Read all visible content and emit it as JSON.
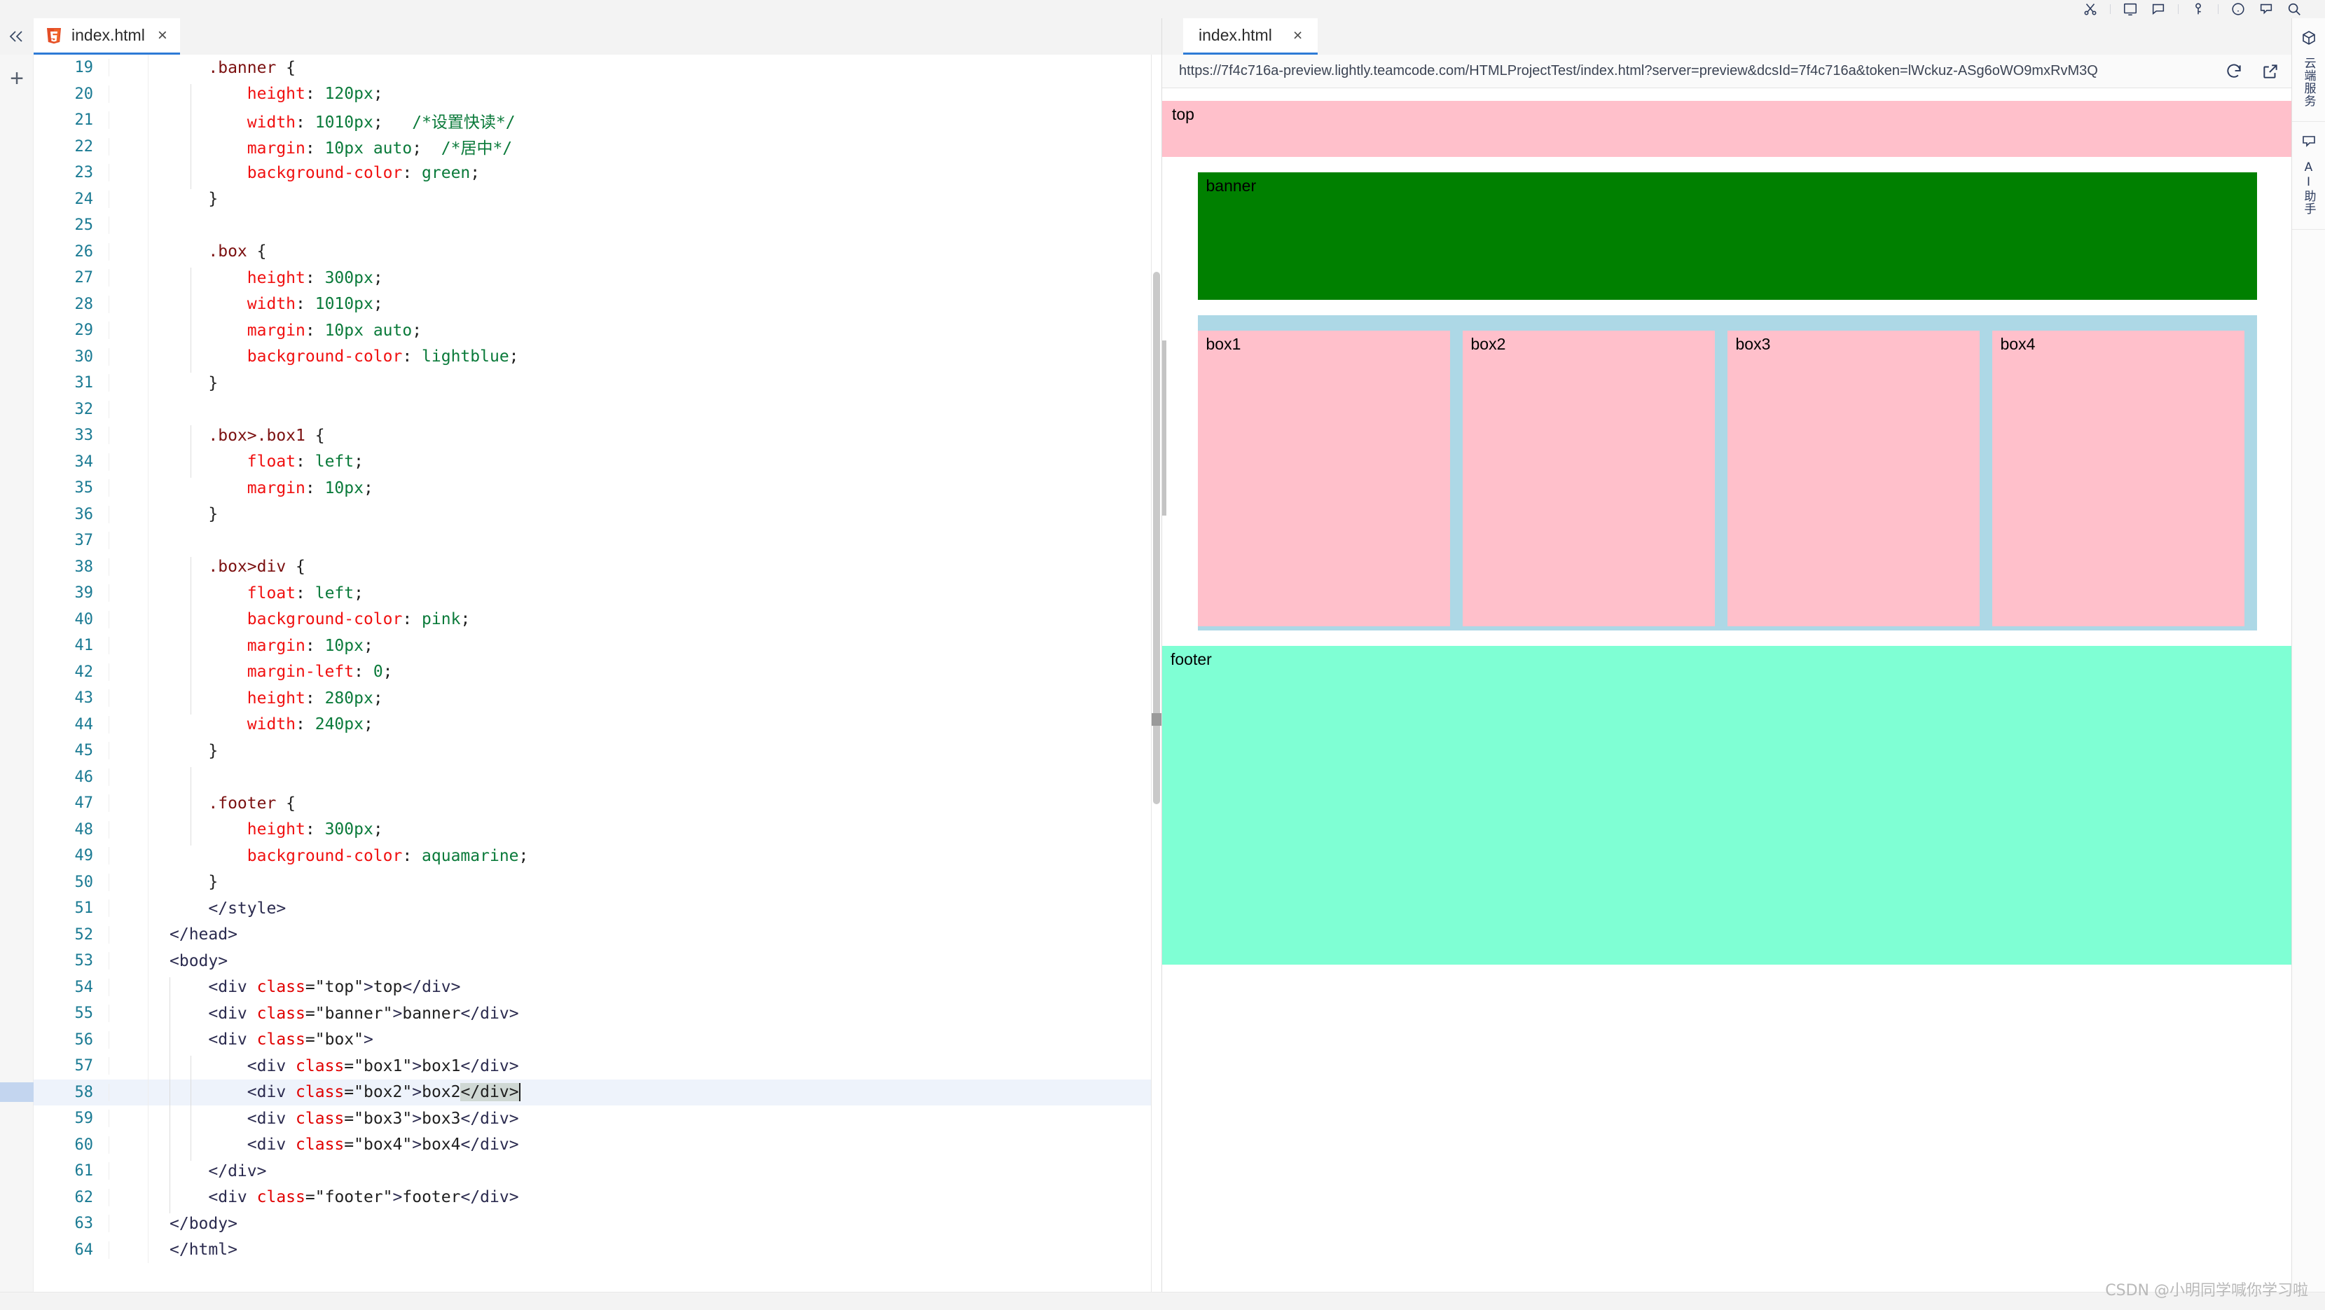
{
  "window": {
    "title": "index.html",
    "ide_toolbar_icons": [
      "scissors-icon",
      "terminal-icon",
      "comment-icon",
      "key-icon",
      "clock-icon",
      "chat-icon",
      "search-icon"
    ]
  },
  "editor": {
    "tab": {
      "label": "index.html",
      "icon": "html5-icon",
      "close": "×"
    },
    "collapse_icon": "chevron-double-left-icon",
    "add_icon": "+",
    "active_line": 58,
    "first_line": 19,
    "last_line": 64,
    "lines": [
      {
        "n": 19,
        "indent": 1,
        "tokens": [
          {
            "t": "sel",
            "v": ".banner"
          },
          {
            "t": "punc",
            "v": " {"
          }
        ]
      },
      {
        "n": 20,
        "indent": 2,
        "tokens": [
          {
            "t": "prop",
            "v": "height"
          },
          {
            "t": "punc",
            "v": ": "
          },
          {
            "t": "val",
            "v": "120px"
          },
          {
            "t": "punc",
            "v": ";"
          }
        ]
      },
      {
        "n": 21,
        "indent": 2,
        "tokens": [
          {
            "t": "prop",
            "v": "width"
          },
          {
            "t": "punc",
            "v": ": "
          },
          {
            "t": "val",
            "v": "1010px"
          },
          {
            "t": "punc",
            "v": ";"
          },
          {
            "t": "punc",
            "v": "   "
          },
          {
            "t": "com",
            "v": "/*设置快读*/"
          }
        ]
      },
      {
        "n": 22,
        "indent": 2,
        "tokens": [
          {
            "t": "prop",
            "v": "margin"
          },
          {
            "t": "punc",
            "v": ": "
          },
          {
            "t": "val",
            "v": "10px auto"
          },
          {
            "t": "punc",
            "v": ";"
          },
          {
            "t": "punc",
            "v": "  "
          },
          {
            "t": "com",
            "v": "/*居中*/"
          }
        ]
      },
      {
        "n": 23,
        "indent": 2,
        "tokens": [
          {
            "t": "prop",
            "v": "background-color"
          },
          {
            "t": "punc",
            "v": ": "
          },
          {
            "t": "val",
            "v": "green"
          },
          {
            "t": "punc",
            "v": ";"
          }
        ]
      },
      {
        "n": 24,
        "indent": 1,
        "tokens": [
          {
            "t": "punc",
            "v": "}"
          }
        ]
      },
      {
        "n": 25,
        "indent": 0,
        "tokens": []
      },
      {
        "n": 26,
        "indent": 1,
        "tokens": [
          {
            "t": "sel",
            "v": ".box"
          },
          {
            "t": "punc",
            "v": " {"
          }
        ]
      },
      {
        "n": 27,
        "indent": 2,
        "tokens": [
          {
            "t": "prop",
            "v": "height"
          },
          {
            "t": "punc",
            "v": ": "
          },
          {
            "t": "val",
            "v": "300px"
          },
          {
            "t": "punc",
            "v": ";"
          }
        ]
      },
      {
        "n": 28,
        "indent": 2,
        "tokens": [
          {
            "t": "prop",
            "v": "width"
          },
          {
            "t": "punc",
            "v": ": "
          },
          {
            "t": "val",
            "v": "1010px"
          },
          {
            "t": "punc",
            "v": ";"
          }
        ]
      },
      {
        "n": 29,
        "indent": 2,
        "tokens": [
          {
            "t": "prop",
            "v": "margin"
          },
          {
            "t": "punc",
            "v": ": "
          },
          {
            "t": "val",
            "v": "10px auto"
          },
          {
            "t": "punc",
            "v": ";"
          }
        ]
      },
      {
        "n": 30,
        "indent": 2,
        "tokens": [
          {
            "t": "prop",
            "v": "background-color"
          },
          {
            "t": "punc",
            "v": ": "
          },
          {
            "t": "val",
            "v": "lightblue"
          },
          {
            "t": "punc",
            "v": ";"
          }
        ]
      },
      {
        "n": 31,
        "indent": 1,
        "tokens": [
          {
            "t": "punc",
            "v": "}"
          }
        ]
      },
      {
        "n": 32,
        "indent": 0,
        "tokens": []
      },
      {
        "n": 33,
        "indent": 1,
        "tokens": [
          {
            "t": "sel",
            "v": ".box>.box1"
          },
          {
            "t": "punc",
            "v": " {"
          }
        ]
      },
      {
        "n": 34,
        "indent": 2,
        "tokens": [
          {
            "t": "prop",
            "v": "float"
          },
          {
            "t": "punc",
            "v": ": "
          },
          {
            "t": "val",
            "v": "left"
          },
          {
            "t": "punc",
            "v": ";"
          }
        ]
      },
      {
        "n": 35,
        "indent": 2,
        "tokens": [
          {
            "t": "prop",
            "v": "margin"
          },
          {
            "t": "punc",
            "v": ": "
          },
          {
            "t": "val",
            "v": "10px"
          },
          {
            "t": "punc",
            "v": ";"
          }
        ]
      },
      {
        "n": 36,
        "indent": 1,
        "tokens": [
          {
            "t": "punc",
            "v": "}"
          }
        ]
      },
      {
        "n": 37,
        "indent": 0,
        "tokens": []
      },
      {
        "n": 38,
        "indent": 1,
        "tokens": [
          {
            "t": "sel",
            "v": ".box>div"
          },
          {
            "t": "punc",
            "v": " {"
          }
        ]
      },
      {
        "n": 39,
        "indent": 2,
        "tokens": [
          {
            "t": "prop",
            "v": "float"
          },
          {
            "t": "punc",
            "v": ": "
          },
          {
            "t": "val",
            "v": "left"
          },
          {
            "t": "punc",
            "v": ";"
          }
        ]
      },
      {
        "n": 40,
        "indent": 2,
        "tokens": [
          {
            "t": "prop",
            "v": "background-color"
          },
          {
            "t": "punc",
            "v": ": "
          },
          {
            "t": "val",
            "v": "pink"
          },
          {
            "t": "punc",
            "v": ";"
          }
        ]
      },
      {
        "n": 41,
        "indent": 2,
        "tokens": [
          {
            "t": "prop",
            "v": "margin"
          },
          {
            "t": "punc",
            "v": ": "
          },
          {
            "t": "val",
            "v": "10px"
          },
          {
            "t": "punc",
            "v": ";"
          }
        ]
      },
      {
        "n": 42,
        "indent": 2,
        "tokens": [
          {
            "t": "prop",
            "v": "margin-left"
          },
          {
            "t": "punc",
            "v": ": "
          },
          {
            "t": "val",
            "v": "0"
          },
          {
            "t": "punc",
            "v": ";"
          }
        ]
      },
      {
        "n": 43,
        "indent": 2,
        "tokens": [
          {
            "t": "prop",
            "v": "height"
          },
          {
            "t": "punc",
            "v": ": "
          },
          {
            "t": "val",
            "v": "280px"
          },
          {
            "t": "punc",
            "v": ";"
          }
        ]
      },
      {
        "n": 44,
        "indent": 2,
        "tokens": [
          {
            "t": "prop",
            "v": "width"
          },
          {
            "t": "punc",
            "v": ": "
          },
          {
            "t": "val",
            "v": "240px"
          },
          {
            "t": "punc",
            "v": ";"
          }
        ]
      },
      {
        "n": 45,
        "indent": 1,
        "tokens": [
          {
            "t": "punc",
            "v": "}"
          }
        ]
      },
      {
        "n": 46,
        "indent": 0,
        "tokens": []
      },
      {
        "n": 47,
        "indent": 1,
        "tokens": [
          {
            "t": "sel",
            "v": ".footer"
          },
          {
            "t": "punc",
            "v": " {"
          }
        ]
      },
      {
        "n": 48,
        "indent": 2,
        "tokens": [
          {
            "t": "prop",
            "v": "height"
          },
          {
            "t": "punc",
            "v": ": "
          },
          {
            "t": "val",
            "v": "300px"
          },
          {
            "t": "punc",
            "v": ";"
          }
        ]
      },
      {
        "n": 49,
        "indent": 2,
        "tokens": [
          {
            "t": "prop",
            "v": "background-color"
          },
          {
            "t": "punc",
            "v": ": "
          },
          {
            "t": "val",
            "v": "aquamarine"
          },
          {
            "t": "punc",
            "v": ";"
          }
        ]
      },
      {
        "n": 50,
        "indent": 1,
        "tokens": [
          {
            "t": "punc",
            "v": "}"
          }
        ]
      },
      {
        "n": 51,
        "indent": 1,
        "tokens": [
          {
            "t": "tag",
            "v": "</style>"
          }
        ]
      },
      {
        "n": 52,
        "indent": 0,
        "tokens": [
          {
            "t": "tag",
            "v": "</head>"
          }
        ]
      },
      {
        "n": 53,
        "indent": 0,
        "tokens": [
          {
            "t": "tag",
            "v": "<body>"
          }
        ]
      },
      {
        "n": 54,
        "indent": 1,
        "tokens": [
          {
            "t": "tag",
            "v": "<div "
          },
          {
            "t": "attr",
            "v": "class"
          },
          {
            "t": "punc",
            "v": "="
          },
          {
            "t": "str",
            "v": "\"top\""
          },
          {
            "t": "tag",
            "v": ">"
          },
          {
            "t": "txt",
            "v": "top"
          },
          {
            "t": "tag",
            "v": "</div>"
          }
        ]
      },
      {
        "n": 55,
        "indent": 1,
        "tokens": [
          {
            "t": "tag",
            "v": "<div "
          },
          {
            "t": "attr",
            "v": "class"
          },
          {
            "t": "punc",
            "v": "="
          },
          {
            "t": "str",
            "v": "\"banner\""
          },
          {
            "t": "tag",
            "v": ">"
          },
          {
            "t": "txt",
            "v": "banner"
          },
          {
            "t": "tag",
            "v": "</div>"
          }
        ]
      },
      {
        "n": 56,
        "indent": 1,
        "tokens": [
          {
            "t": "tag",
            "v": "<div "
          },
          {
            "t": "attr",
            "v": "class"
          },
          {
            "t": "punc",
            "v": "="
          },
          {
            "t": "str",
            "v": "\"box\""
          },
          {
            "t": "tag",
            "v": ">"
          }
        ]
      },
      {
        "n": 57,
        "indent": 2,
        "tokens": [
          {
            "t": "tag",
            "v": "<div "
          },
          {
            "t": "attr",
            "v": "class"
          },
          {
            "t": "punc",
            "v": "="
          },
          {
            "t": "str",
            "v": "\"box1\""
          },
          {
            "t": "tag",
            "v": ">"
          },
          {
            "t": "txt",
            "v": "box1"
          },
          {
            "t": "tag",
            "v": "</div>"
          }
        ]
      },
      {
        "n": 58,
        "indent": 2,
        "tokens": [
          {
            "t": "tag",
            "v": "<div "
          },
          {
            "t": "attr",
            "v": "class"
          },
          {
            "t": "punc",
            "v": "="
          },
          {
            "t": "str",
            "v": "\"box2\""
          },
          {
            "t": "tag",
            "v": ">"
          },
          {
            "t": "txt",
            "v": "box2"
          },
          {
            "t": "sel-chip",
            "v": "</div"
          },
          {
            "t": "sel-chip",
            "v": ">"
          },
          {
            "t": "caret",
            "v": ""
          }
        ]
      },
      {
        "n": 59,
        "indent": 2,
        "tokens": [
          {
            "t": "tag",
            "v": "<div "
          },
          {
            "t": "attr",
            "v": "class"
          },
          {
            "t": "punc",
            "v": "="
          },
          {
            "t": "str",
            "v": "\"box3\""
          },
          {
            "t": "tag",
            "v": ">"
          },
          {
            "t": "txt",
            "v": "box3"
          },
          {
            "t": "tag",
            "v": "</div>"
          }
        ]
      },
      {
        "n": 60,
        "indent": 2,
        "tokens": [
          {
            "t": "tag",
            "v": "<div "
          },
          {
            "t": "attr",
            "v": "class"
          },
          {
            "t": "punc",
            "v": "="
          },
          {
            "t": "str",
            "v": "\"box4\""
          },
          {
            "t": "tag",
            "v": ">"
          },
          {
            "t": "txt",
            "v": "box4"
          },
          {
            "t": "tag",
            "v": "</div>"
          }
        ]
      },
      {
        "n": 61,
        "indent": 1,
        "tokens": [
          {
            "t": "tag",
            "v": "</div>"
          }
        ]
      },
      {
        "n": 62,
        "indent": 1,
        "tokens": [
          {
            "t": "tag",
            "v": "<div "
          },
          {
            "t": "attr",
            "v": "class"
          },
          {
            "t": "punc",
            "v": "="
          },
          {
            "t": "str",
            "v": "\"footer\""
          },
          {
            "t": "tag",
            "v": ">"
          },
          {
            "t": "txt",
            "v": "footer"
          },
          {
            "t": "tag",
            "v": "</div>"
          }
        ]
      },
      {
        "n": 63,
        "indent": 0,
        "tokens": [
          {
            "t": "tag",
            "v": "</body>"
          }
        ]
      },
      {
        "n": 64,
        "indent": 0,
        "tokens": [
          {
            "t": "tag",
            "v": "</html>"
          }
        ]
      }
    ]
  },
  "browser": {
    "tab": {
      "label": "index.html",
      "close": "×"
    },
    "url": "https://7f4c716a-preview.lightly.teamcode.com/HTMLProjectTest/index.html?server=preview&dcsId=7f4c716a&token=lWckuz-ASg6oWO9mxRvM3Q",
    "actions": [
      {
        "name": "reload-icon",
        "label": "↻"
      },
      {
        "name": "open-external-icon",
        "label": "↗"
      }
    ]
  },
  "preview": {
    "blocks": [
      {
        "name": "top",
        "label": "top",
        "color": "#ffc0cb"
      },
      {
        "name": "banner",
        "label": "banner",
        "color": "#008000"
      },
      {
        "name": "box",
        "label": "",
        "color": "#add8e6"
      },
      {
        "name": "footer",
        "label": "footer",
        "color": "#7fffd4"
      }
    ],
    "inner_boxes": [
      {
        "name": "box1",
        "label": "box1",
        "color": "#ffc0cb"
      },
      {
        "name": "box2",
        "label": "box2",
        "color": "#ffc0cb"
      },
      {
        "name": "box3",
        "label": "box3",
        "color": "#ffc0cb"
      },
      {
        "name": "box4",
        "label": "box4",
        "color": "#ffc0cb"
      }
    ]
  },
  "right_sidebar": {
    "items": [
      {
        "name": "cloud-service",
        "icon": "cube-icon",
        "label": "云端服务"
      },
      {
        "name": "ai-assistant",
        "icon": "chat-icon",
        "label": "AI助手"
      }
    ]
  },
  "watermark": {
    "text": "CSDN @小明同学喊你学习啦"
  }
}
